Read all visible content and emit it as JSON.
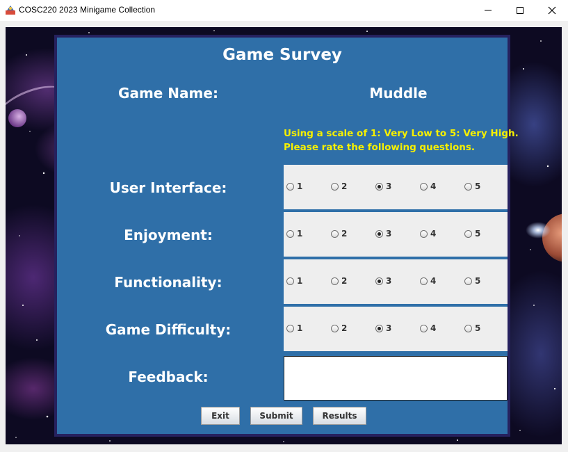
{
  "window": {
    "title": "COSC220 2023 Minigame Collection",
    "controls": [
      "minimize-icon",
      "maximize-icon",
      "close-icon"
    ]
  },
  "survey": {
    "title": "Game Survey",
    "game_name_label": "Game Name:",
    "game_name_value": "Muddle",
    "instructions": [
      "Using a scale of 1: Very Low to 5: Very High.",
      "Please rate the following questions."
    ],
    "questions": [
      {
        "label": "User Interface:",
        "options": [
          "1",
          "2",
          "3",
          "4",
          "5"
        ],
        "selected": "3"
      },
      {
        "label": "Enjoyment:",
        "options": [
          "1",
          "2",
          "3",
          "4",
          "5"
        ],
        "selected": "3"
      },
      {
        "label": "Functionality:",
        "options": [
          "1",
          "2",
          "3",
          "4",
          "5"
        ],
        "selected": "3"
      },
      {
        "label": "Game Difficulty:",
        "options": [
          "1",
          "2",
          "3",
          "4",
          "5"
        ],
        "selected": "3"
      }
    ],
    "feedback_label": "Feedback:",
    "feedback_value": "",
    "buttons": {
      "exit": "Exit",
      "submit": "Submit",
      "results": "Results"
    }
  },
  "colors": {
    "panel": "#2f6fa8",
    "panel_border": "#26215e",
    "instructions_text": "#f6f000",
    "label_text": "#ffffff"
  }
}
